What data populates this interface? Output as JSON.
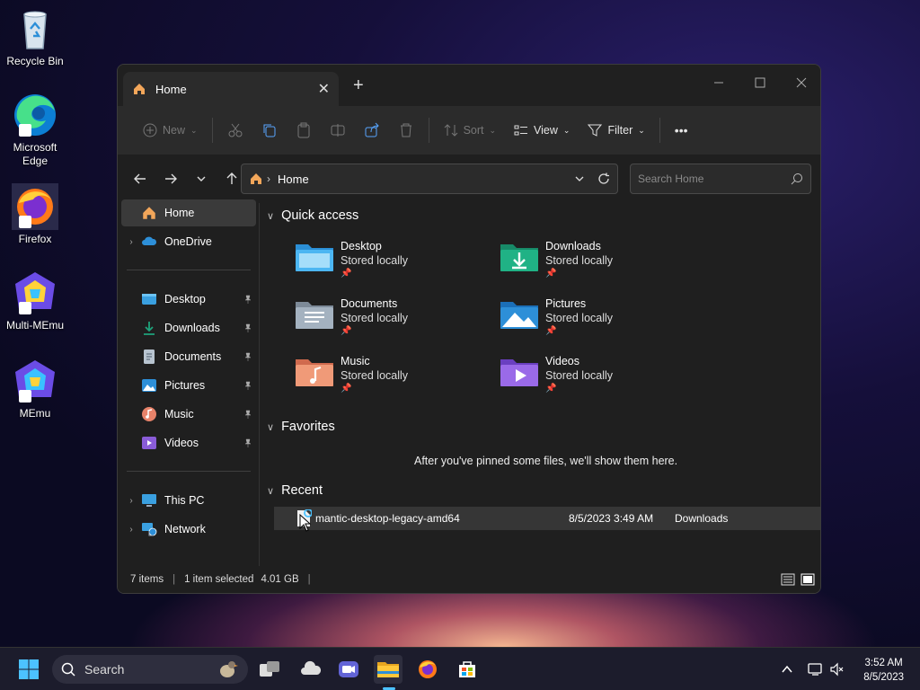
{
  "desktop": {
    "icons": [
      {
        "label": "Recycle Bin"
      },
      {
        "label": "Microsoft Edge"
      },
      {
        "label": "Firefox"
      },
      {
        "label": "Multi-MEmu"
      },
      {
        "label": "MEmu"
      }
    ]
  },
  "window": {
    "tab_title": "Home",
    "tab_close": "✕",
    "new_tab": "+",
    "toolbar": {
      "new": "New",
      "sort": "Sort",
      "view": "View",
      "filter": "Filter",
      "more": "•••"
    },
    "address": {
      "path": "Home",
      "separator": "›"
    },
    "search": {
      "placeholder": "Search Home"
    },
    "sidebar": {
      "items": [
        {
          "label": "Home"
        },
        {
          "label": "OneDrive"
        },
        {
          "label": "Desktop"
        },
        {
          "label": "Downloads"
        },
        {
          "label": "Documents"
        },
        {
          "label": "Pictures"
        },
        {
          "label": "Music"
        },
        {
          "label": "Videos"
        },
        {
          "label": "This PC"
        },
        {
          "label": "Network"
        }
      ]
    },
    "quick_access": {
      "heading": "Quick access",
      "items": [
        {
          "name": "Desktop",
          "status": "Stored locally"
        },
        {
          "name": "Downloads",
          "status": "Stored locally"
        },
        {
          "name": "Documents",
          "status": "Stored locally"
        },
        {
          "name": "Pictures",
          "status": "Stored locally"
        },
        {
          "name": "Music",
          "status": "Stored locally"
        },
        {
          "name": "Videos",
          "status": "Stored locally"
        }
      ]
    },
    "favorites": {
      "heading": "Favorites",
      "empty_message": "After you've pinned some files, we'll show them here."
    },
    "recent": {
      "heading": "Recent",
      "rows": [
        {
          "name": "mantic-desktop-legacy-amd64",
          "date": "8/5/2023 3:49 AM",
          "location": "Downloads"
        }
      ]
    },
    "status": {
      "items": "7 items",
      "selected": "1 item selected",
      "size": "4.01 GB",
      "separator": "|"
    }
  },
  "taskbar": {
    "search_label": "Search",
    "time": "3:52 AM",
    "date": "8/5/2023"
  },
  "colors": {
    "accent": "#4cc2ff",
    "folder_blue": "#3aa0e0",
    "folder_green": "#1fa37c",
    "window_bg": "#1f1f1f"
  }
}
